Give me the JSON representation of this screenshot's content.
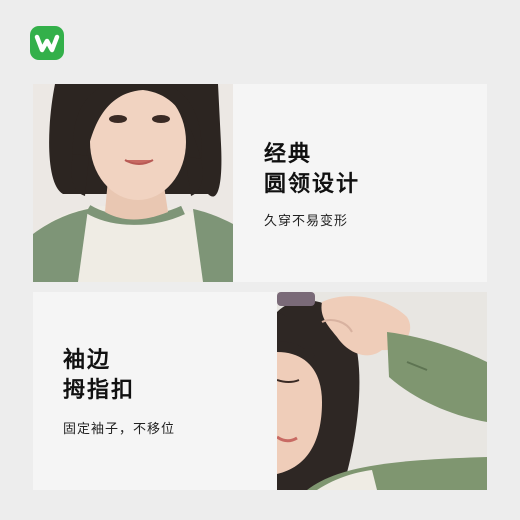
{
  "logo": {
    "icon": "brand-logo-icon",
    "color": "#33b04a"
  },
  "section1": {
    "title_line1": "经典",
    "title_line2": "圆领设计",
    "subtitle": "久穿不易变形"
  },
  "section2": {
    "title_line1": "袖边",
    "title_line2": "拇指扣",
    "subtitle": "固定袖子，不移位"
  }
}
